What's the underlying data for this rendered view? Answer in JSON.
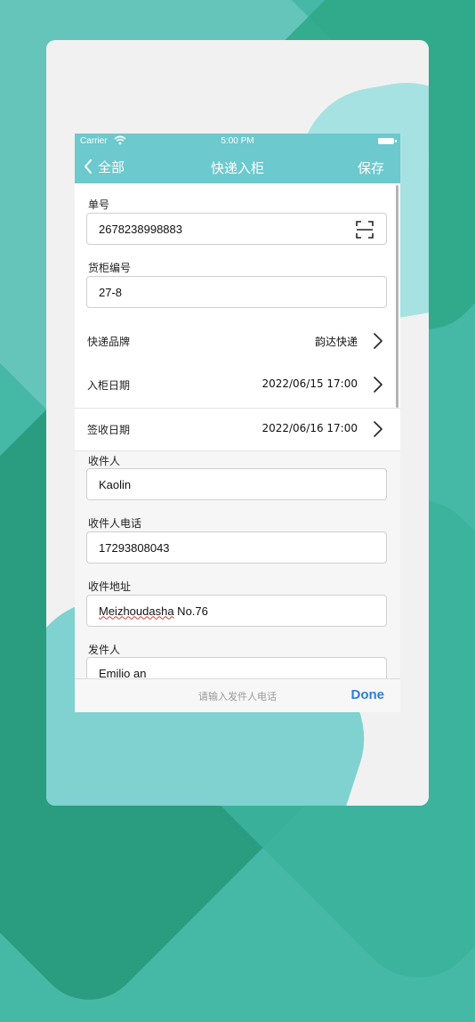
{
  "status": {
    "carrier": "Carrier",
    "time": "5:00 PM"
  },
  "nav": {
    "back_label": "全部",
    "title": "快递入柜",
    "save_label": "保存"
  },
  "form": {
    "tracking": {
      "label": "单号",
      "value": "2678238998883"
    },
    "locker": {
      "label": "货柜编号",
      "value": "27-8"
    },
    "brand": {
      "label": "快递品牌",
      "value": "韵达快递"
    },
    "in_date": {
      "label": "入柜日期",
      "value": "2022/06/15 17:00"
    },
    "sign_date": {
      "label": "签收日期",
      "value": "2022/06/16 17:00"
    },
    "recipient": {
      "label": "收件人",
      "value": "Kaolin"
    },
    "recipient_phone": {
      "label": "收件人电话",
      "value": "17293808043"
    },
    "recipient_address": {
      "label": "收件地址",
      "value": "Meizhoudasha No.76",
      "value_word": "Meizhoudasha",
      "value_rest": " No.76"
    },
    "sender": {
      "label": "发件人",
      "value": "Emilio an"
    }
  },
  "keyboard_toolbar": {
    "hint": "请输入发件人电话",
    "done_label": "Done"
  },
  "colors": {
    "nav": "#6cc9cd",
    "done": "#2c7fd6",
    "background": "#46b8a6"
  },
  "icons": [
    "wifi-icon",
    "battery-icon",
    "back-chevron-icon",
    "scan-icon",
    "chevron-right-icon"
  ]
}
